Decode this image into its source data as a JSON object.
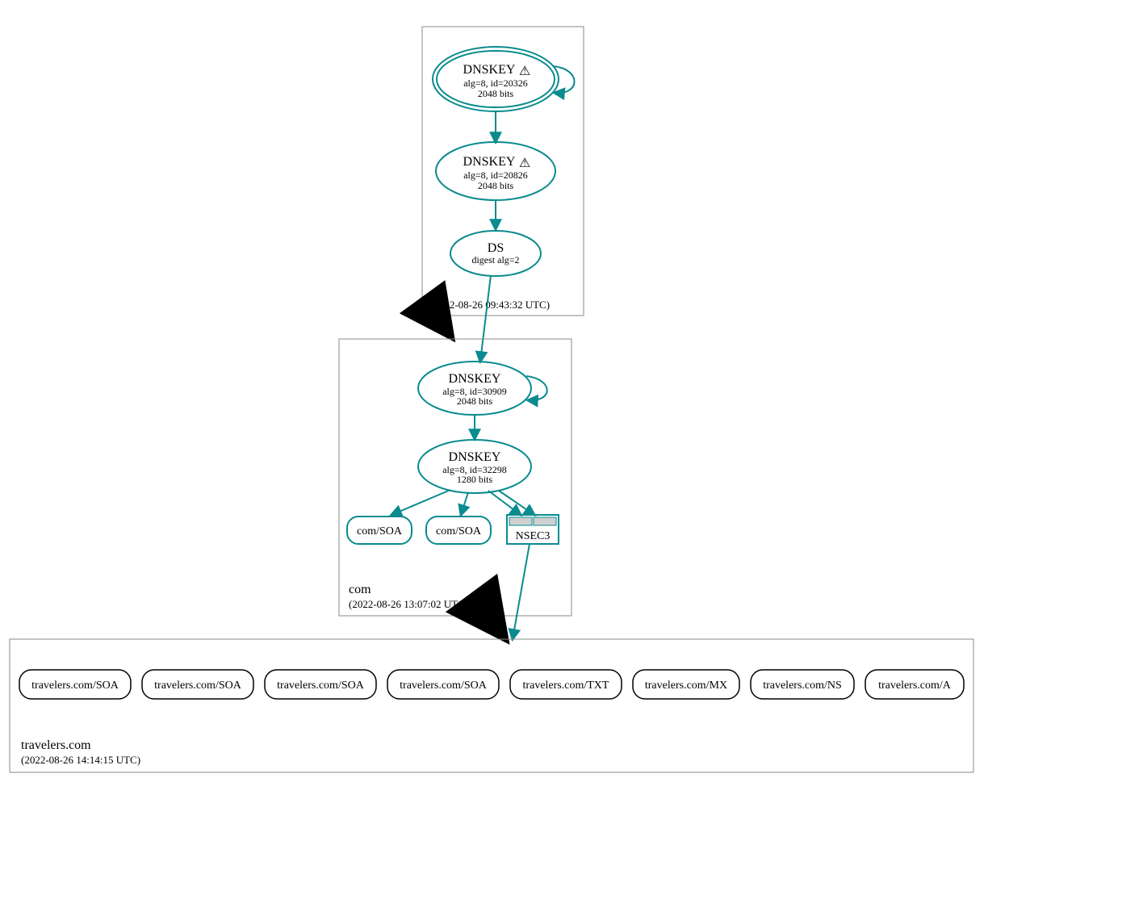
{
  "zones": {
    "root": {
      "name": ".",
      "timestamp": "(2022-08-26 09:43:32 UTC)",
      "dnskey1": {
        "title": "DNSKEY",
        "line1": "alg=8, id=20326",
        "line2": "2048 bits",
        "warn": "⚠"
      },
      "dnskey2": {
        "title": "DNSKEY",
        "line1": "alg=8, id=20826",
        "line2": "2048 bits",
        "warn": "⚠"
      },
      "ds": {
        "title": "DS",
        "line1": "digest alg=2"
      }
    },
    "com": {
      "name": "com",
      "timestamp": "(2022-08-26 13:07:02 UTC)",
      "dnskey1": {
        "title": "DNSKEY",
        "line1": "alg=8, id=30909",
        "line2": "2048 bits"
      },
      "dnskey2": {
        "title": "DNSKEY",
        "line1": "alg=8, id=32298",
        "line2": "1280 bits"
      },
      "soa1": "com/SOA",
      "soa2": "com/SOA",
      "nsec3": "NSEC3"
    },
    "travelers": {
      "name": "travelers.com",
      "timestamp": "(2022-08-26 14:14:15 UTC)",
      "records": [
        "travelers.com/SOA",
        "travelers.com/SOA",
        "travelers.com/SOA",
        "travelers.com/SOA",
        "travelers.com/TXT",
        "travelers.com/MX",
        "travelers.com/NS",
        "travelers.com/A"
      ]
    }
  }
}
